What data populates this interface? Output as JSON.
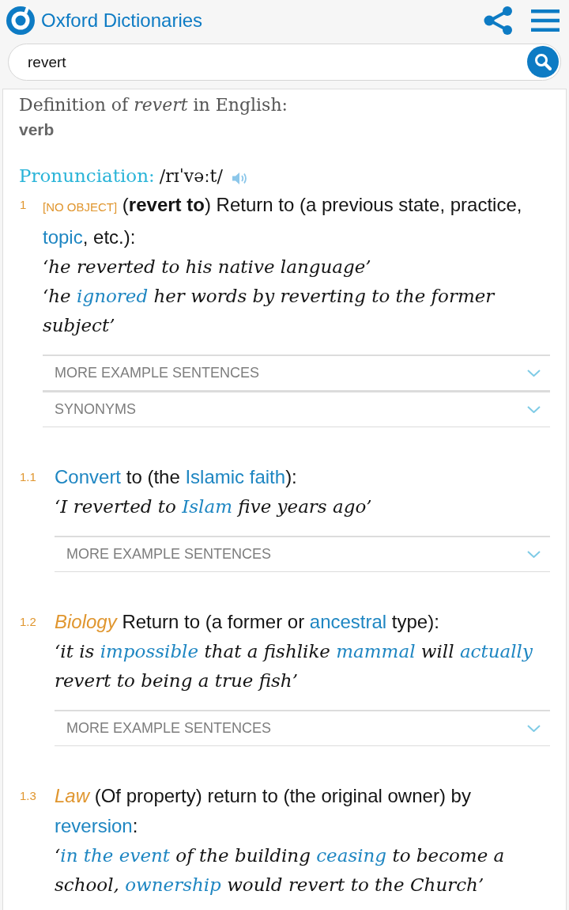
{
  "header": {
    "logo_text": "Oxford Dictionaries"
  },
  "search": {
    "value": "revert"
  },
  "entry": {
    "heading": "Definition of *revert* in English:",
    "part_of_speech": "verb",
    "pronunciation": {
      "label": "Pronunciation:",
      "ipa": "/rɪˈvəːt/"
    },
    "senses": [
      {
        "number": "1",
        "definition": [
          {
            "kind": "grammar",
            "text": "[NO OBJECT]"
          },
          {
            "kind": "text",
            "text": " (**revert to**) Return to (a previous state, practice, "
          },
          {
            "kind": "link",
            "text": "topic"
          },
          {
            "kind": "text",
            "text": ", etc.):"
          }
        ],
        "examples": [
          [
            {
              "kind": "text",
              "text": "‘he reverted to his native language’"
            }
          ],
          [
            {
              "kind": "text",
              "text": "‘he "
            },
            {
              "kind": "link",
              "text": "ignored"
            },
            {
              "kind": "text",
              "text": " her words by reverting to the former subject’"
            }
          ]
        ],
        "panels": [
          {
            "label": "MORE EXAMPLE SENTENCES",
            "expanded": false
          },
          {
            "label": "SYNONYMS",
            "expanded": false
          }
        ],
        "children": [
          {
            "number": "1.1",
            "definition": [
              {
                "kind": "link",
                "text": "Convert"
              },
              {
                "kind": "text",
                "text": " to (the "
              },
              {
                "kind": "link",
                "text": "Islamic faith"
              },
              {
                "kind": "text",
                "text": "):"
              }
            ],
            "examples": [
              [
                {
                  "kind": "text",
                  "text": "‘I reverted to "
                },
                {
                  "kind": "link",
                  "text": "Islam"
                },
                {
                  "kind": "text",
                  "text": " five years ago’"
                }
              ]
            ],
            "panels": [
              {
                "label": "MORE EXAMPLE SENTENCES",
                "expanded": false
              }
            ]
          },
          {
            "number": "1.2",
            "definition": [
              {
                "kind": "subject",
                "text": "Biology"
              },
              {
                "kind": "text",
                "text": " Return to (a former or "
              },
              {
                "kind": "link",
                "text": "ancestral"
              },
              {
                "kind": "text",
                "text": " type):"
              }
            ],
            "examples": [
              [
                {
                  "kind": "text",
                  "text": "‘it is "
                },
                {
                  "kind": "link",
                  "text": "impossible"
                },
                {
                  "kind": "text",
                  "text": " that a fishlike "
                },
                {
                  "kind": "link",
                  "text": "mammal"
                },
                {
                  "kind": "text",
                  "text": " will "
                },
                {
                  "kind": "link",
                  "text": "actually"
                },
                {
                  "kind": "text",
                  "text": " revert to being a true fish’"
                }
              ]
            ],
            "panels": [
              {
                "label": "MORE EXAMPLE SENTENCES",
                "expanded": false
              }
            ]
          },
          {
            "number": "1.3",
            "definition": [
              {
                "kind": "subject",
                "text": "Law"
              },
              {
                "kind": "text",
                "text": " (Of property) return to (the original owner) by "
              },
              {
                "kind": "link",
                "text": "reversion"
              },
              {
                "kind": "text",
                "text": ":"
              }
            ],
            "examples": [
              [
                {
                  "kind": "text",
                  "text": "‘"
                },
                {
                  "kind": "link",
                  "text": "in the event"
                },
                {
                  "kind": "text",
                  "text": " of the building "
                },
                {
                  "kind": "link",
                  "text": "ceasing"
                },
                {
                  "kind": "text",
                  "text": " to become a school, "
                },
                {
                  "kind": "link",
                  "text": "ownership"
                },
                {
                  "kind": "text",
                  "text": " would revert to the Church’"
                }
              ]
            ]
          }
        ]
      }
    ]
  }
}
